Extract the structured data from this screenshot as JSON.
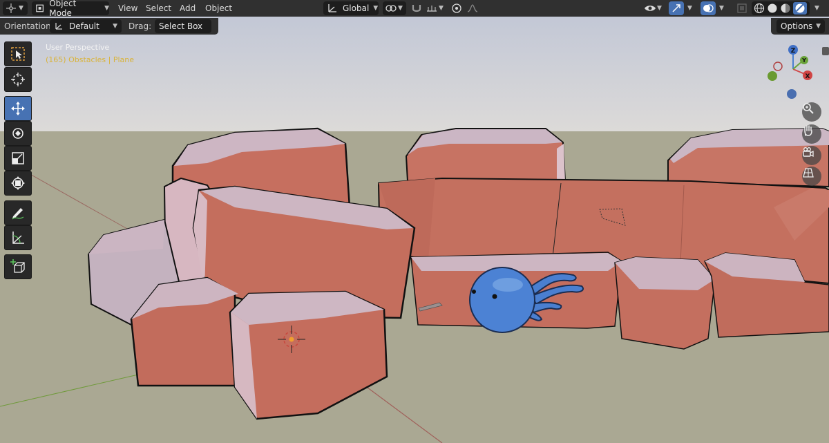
{
  "header": {
    "mode": "Object Mode",
    "menus": [
      "View",
      "Select",
      "Add",
      "Object"
    ],
    "transform_orientation": "Global"
  },
  "tool_settings": {
    "orientation_label": "Orientation:",
    "orientation_value": "Default",
    "drag_label": "Drag:",
    "drag_value": "Select Box",
    "options_label": "Options"
  },
  "viewport": {
    "view_name": "User Perspective",
    "object_info_count": "(165)",
    "object_info_rest": "Obstacles | Plane"
  },
  "gizmo": {
    "z": "Z",
    "x": "X",
    "y": "Y"
  },
  "tools": [
    {
      "name": "select-box-tool",
      "icon": "select-box-icon",
      "active": false
    },
    {
      "name": "cursor-tool",
      "icon": "cursor-icon",
      "active": false
    },
    {
      "name": "move-tool",
      "icon": "move-icon",
      "active": true
    },
    {
      "name": "rotate-tool",
      "icon": "rotate-icon",
      "active": false
    },
    {
      "name": "scale-tool",
      "icon": "scale-icon",
      "active": false
    },
    {
      "name": "transform-tool",
      "icon": "transform-icon",
      "active": false
    },
    {
      "name": "annotate-tool",
      "icon": "annotate-icon",
      "active": false
    },
    {
      "name": "measure-tool",
      "icon": "measure-icon",
      "active": false
    },
    {
      "name": "add-cube-tool",
      "icon": "add-cube-icon",
      "active": false
    }
  ],
  "colors": {
    "accent": "#4772b3",
    "header_bg": "#303030",
    "widget_bg": "#1d1d1d",
    "active_object_text": "#d9b33a",
    "ground": "#aaa893",
    "sky": "#c8ccd9",
    "rock": "#c9766a",
    "character": "#4a7fd0"
  }
}
